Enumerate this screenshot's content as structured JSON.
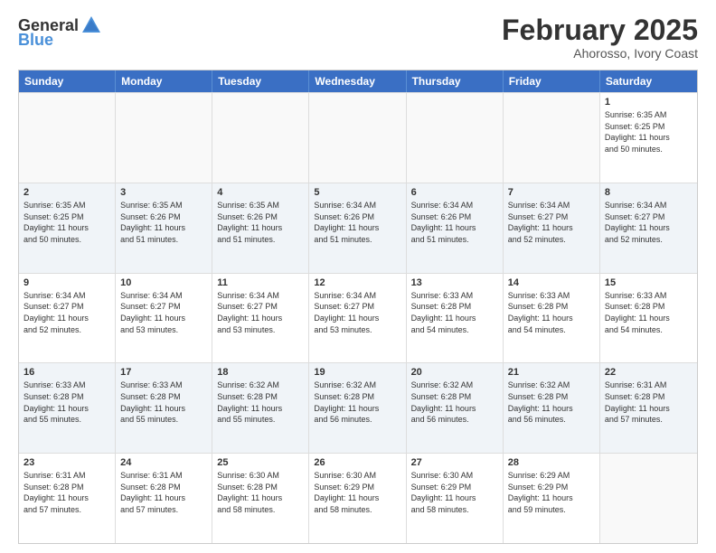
{
  "header": {
    "logo_general": "General",
    "logo_blue": "Blue",
    "month_year": "February 2025",
    "location": "Ahorosso, Ivory Coast"
  },
  "weekdays": [
    "Sunday",
    "Monday",
    "Tuesday",
    "Wednesday",
    "Thursday",
    "Friday",
    "Saturday"
  ],
  "rows": [
    [
      {
        "day": "",
        "text": "",
        "empty": true
      },
      {
        "day": "",
        "text": "",
        "empty": true
      },
      {
        "day": "",
        "text": "",
        "empty": true
      },
      {
        "day": "",
        "text": "",
        "empty": true
      },
      {
        "day": "",
        "text": "",
        "empty": true
      },
      {
        "day": "",
        "text": "",
        "empty": true
      },
      {
        "day": "1",
        "text": "Sunrise: 6:35 AM\nSunset: 6:25 PM\nDaylight: 11 hours\nand 50 minutes.",
        "empty": false
      }
    ],
    [
      {
        "day": "2",
        "text": "Sunrise: 6:35 AM\nSunset: 6:25 PM\nDaylight: 11 hours\nand 50 minutes.",
        "empty": false
      },
      {
        "day": "3",
        "text": "Sunrise: 6:35 AM\nSunset: 6:26 PM\nDaylight: 11 hours\nand 51 minutes.",
        "empty": false
      },
      {
        "day": "4",
        "text": "Sunrise: 6:35 AM\nSunset: 6:26 PM\nDaylight: 11 hours\nand 51 minutes.",
        "empty": false
      },
      {
        "day": "5",
        "text": "Sunrise: 6:34 AM\nSunset: 6:26 PM\nDaylight: 11 hours\nand 51 minutes.",
        "empty": false
      },
      {
        "day": "6",
        "text": "Sunrise: 6:34 AM\nSunset: 6:26 PM\nDaylight: 11 hours\nand 51 minutes.",
        "empty": false
      },
      {
        "day": "7",
        "text": "Sunrise: 6:34 AM\nSunset: 6:27 PM\nDaylight: 11 hours\nand 52 minutes.",
        "empty": false
      },
      {
        "day": "8",
        "text": "Sunrise: 6:34 AM\nSunset: 6:27 PM\nDaylight: 11 hours\nand 52 minutes.",
        "empty": false
      }
    ],
    [
      {
        "day": "9",
        "text": "Sunrise: 6:34 AM\nSunset: 6:27 PM\nDaylight: 11 hours\nand 52 minutes.",
        "empty": false
      },
      {
        "day": "10",
        "text": "Sunrise: 6:34 AM\nSunset: 6:27 PM\nDaylight: 11 hours\nand 53 minutes.",
        "empty": false
      },
      {
        "day": "11",
        "text": "Sunrise: 6:34 AM\nSunset: 6:27 PM\nDaylight: 11 hours\nand 53 minutes.",
        "empty": false
      },
      {
        "day": "12",
        "text": "Sunrise: 6:34 AM\nSunset: 6:27 PM\nDaylight: 11 hours\nand 53 minutes.",
        "empty": false
      },
      {
        "day": "13",
        "text": "Sunrise: 6:33 AM\nSunset: 6:28 PM\nDaylight: 11 hours\nand 54 minutes.",
        "empty": false
      },
      {
        "day": "14",
        "text": "Sunrise: 6:33 AM\nSunset: 6:28 PM\nDaylight: 11 hours\nand 54 minutes.",
        "empty": false
      },
      {
        "day": "15",
        "text": "Sunrise: 6:33 AM\nSunset: 6:28 PM\nDaylight: 11 hours\nand 54 minutes.",
        "empty": false
      }
    ],
    [
      {
        "day": "16",
        "text": "Sunrise: 6:33 AM\nSunset: 6:28 PM\nDaylight: 11 hours\nand 55 minutes.",
        "empty": false
      },
      {
        "day": "17",
        "text": "Sunrise: 6:33 AM\nSunset: 6:28 PM\nDaylight: 11 hours\nand 55 minutes.",
        "empty": false
      },
      {
        "day": "18",
        "text": "Sunrise: 6:32 AM\nSunset: 6:28 PM\nDaylight: 11 hours\nand 55 minutes.",
        "empty": false
      },
      {
        "day": "19",
        "text": "Sunrise: 6:32 AM\nSunset: 6:28 PM\nDaylight: 11 hours\nand 56 minutes.",
        "empty": false
      },
      {
        "day": "20",
        "text": "Sunrise: 6:32 AM\nSunset: 6:28 PM\nDaylight: 11 hours\nand 56 minutes.",
        "empty": false
      },
      {
        "day": "21",
        "text": "Sunrise: 6:32 AM\nSunset: 6:28 PM\nDaylight: 11 hours\nand 56 minutes.",
        "empty": false
      },
      {
        "day": "22",
        "text": "Sunrise: 6:31 AM\nSunset: 6:28 PM\nDaylight: 11 hours\nand 57 minutes.",
        "empty": false
      }
    ],
    [
      {
        "day": "23",
        "text": "Sunrise: 6:31 AM\nSunset: 6:28 PM\nDaylight: 11 hours\nand 57 minutes.",
        "empty": false
      },
      {
        "day": "24",
        "text": "Sunrise: 6:31 AM\nSunset: 6:28 PM\nDaylight: 11 hours\nand 57 minutes.",
        "empty": false
      },
      {
        "day": "25",
        "text": "Sunrise: 6:30 AM\nSunset: 6:28 PM\nDaylight: 11 hours\nand 58 minutes.",
        "empty": false
      },
      {
        "day": "26",
        "text": "Sunrise: 6:30 AM\nSunset: 6:29 PM\nDaylight: 11 hours\nand 58 minutes.",
        "empty": false
      },
      {
        "day": "27",
        "text": "Sunrise: 6:30 AM\nSunset: 6:29 PM\nDaylight: 11 hours\nand 58 minutes.",
        "empty": false
      },
      {
        "day": "28",
        "text": "Sunrise: 6:29 AM\nSunset: 6:29 PM\nDaylight: 11 hours\nand 59 minutes.",
        "empty": false
      },
      {
        "day": "",
        "text": "",
        "empty": true
      }
    ]
  ]
}
